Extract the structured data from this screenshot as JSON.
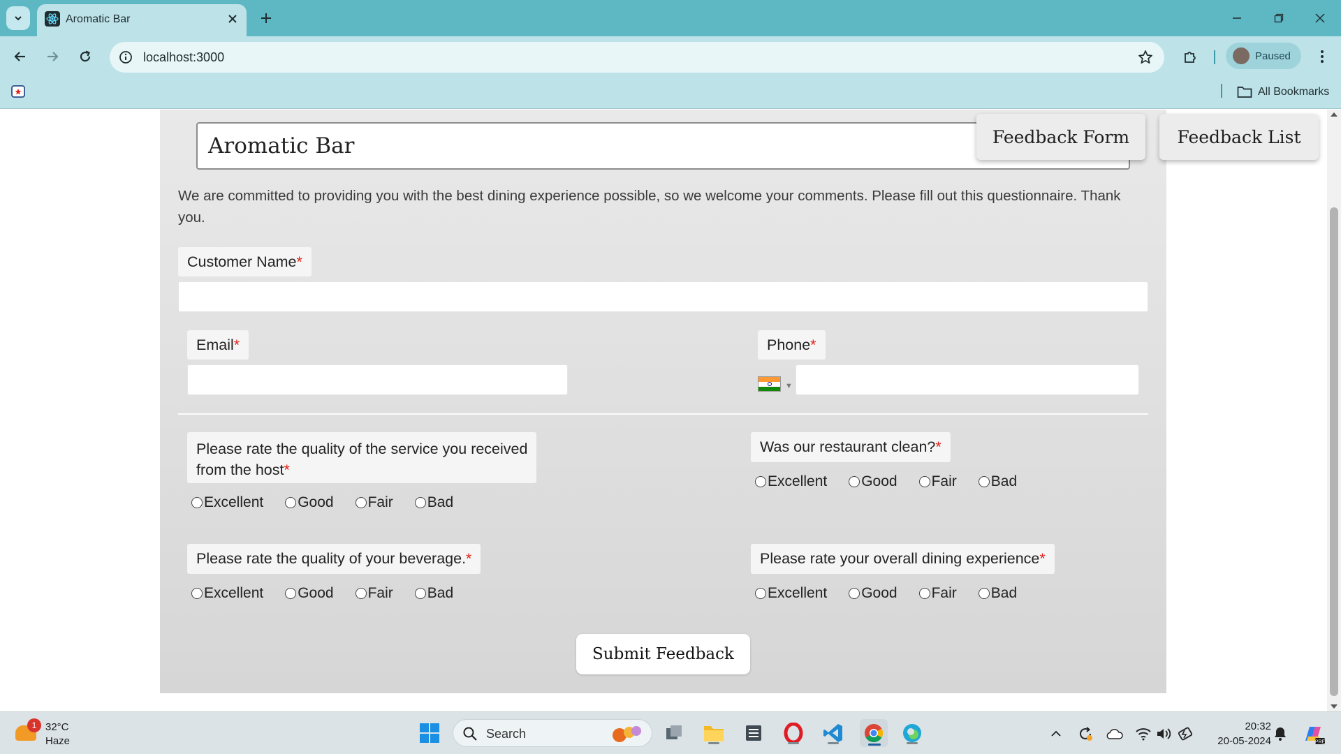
{
  "browser": {
    "tab_title": "Aromatic Bar",
    "url": "localhost:3000",
    "profile_label": "Paused",
    "bookmarks_label": "All Bookmarks"
  },
  "page": {
    "brand": "Aromatic Bar",
    "nav": {
      "feedback_form": "Feedback Form",
      "feedback_list": "Feedback List"
    },
    "intro": "We are committed to providing you with the best dining experience possible, so we welcome your comments. Please fill out this questionnaire. Thank you.",
    "fields": {
      "customer_name": {
        "label": "Customer Name",
        "value": ""
      },
      "email": {
        "label": "Email",
        "value": ""
      },
      "phone": {
        "label": "Phone",
        "value": "",
        "country_flag": "india-flag"
      }
    },
    "required_marker": "*",
    "questions": {
      "host_service": {
        "line1": "Please rate the quality of the service you received",
        "line2": "from the host"
      },
      "cleanliness": {
        "label": "Was our restaurant clean?"
      },
      "beverage": {
        "label": "Please rate the quality of your beverage."
      },
      "overall": {
        "label": "Please rate your overall dining experience"
      }
    },
    "rating_options": [
      "Excellent",
      "Good",
      "Fair",
      "Bad"
    ],
    "submit_label": "Submit Feedback",
    "colors": {
      "required": "#e0241c",
      "chrome_tabbar": "#5db8c4",
      "chrome_toolbar": "#bde3e9"
    }
  },
  "taskbar": {
    "weather_temp": "32°C",
    "weather_desc": "Haze",
    "weather_badge": "1",
    "search_label": "Search",
    "time": "20:32",
    "date": "20-05-2024"
  }
}
